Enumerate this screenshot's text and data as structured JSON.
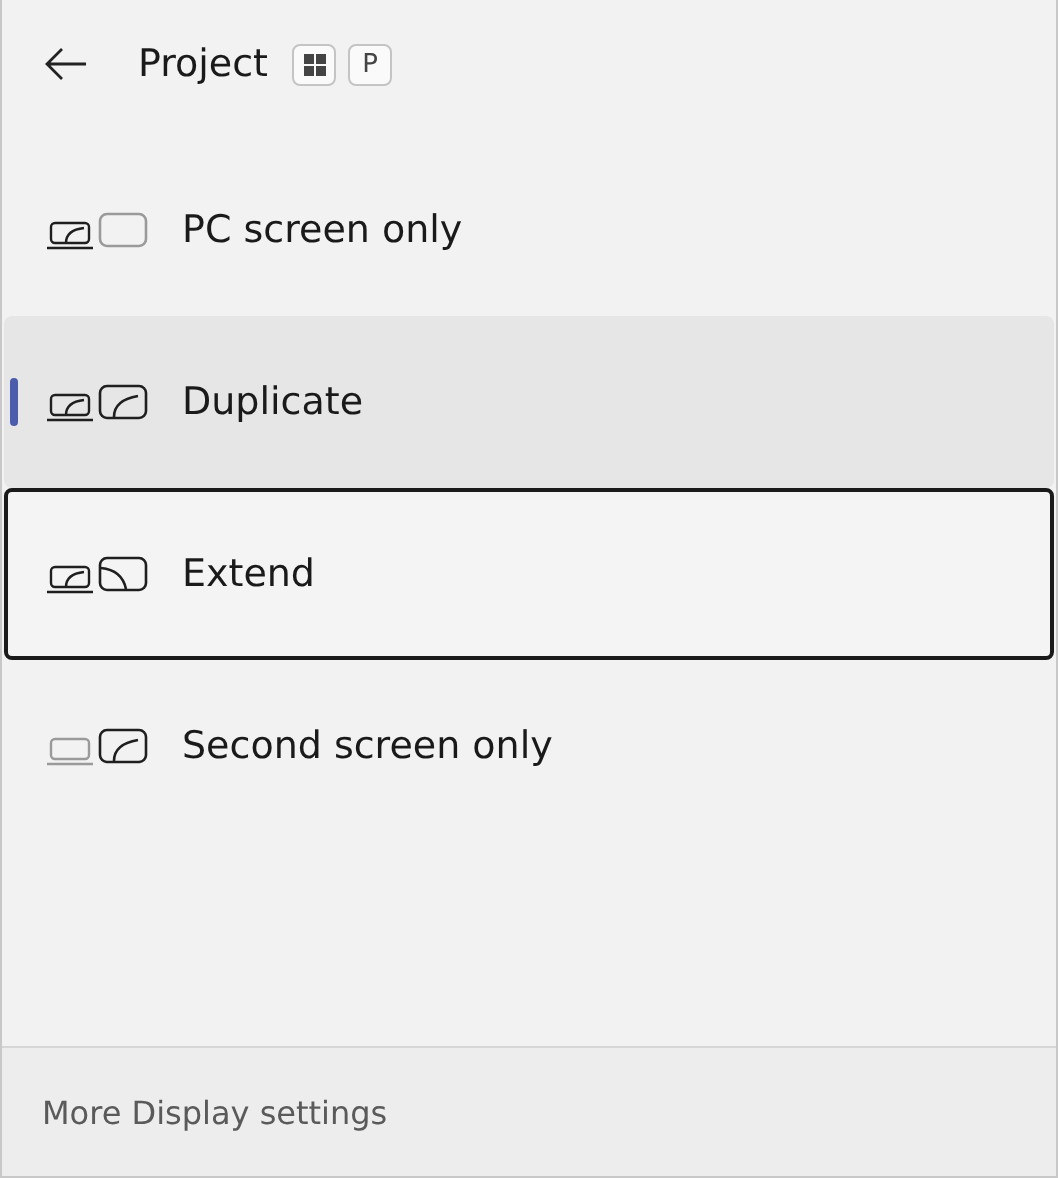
{
  "header": {
    "title": "Project",
    "shortcut_key": "P"
  },
  "options": [
    {
      "kind": "pc_only",
      "label": "PC screen only",
      "selected": false,
      "focused": false
    },
    {
      "kind": "duplicate",
      "label": "Duplicate",
      "selected": true,
      "focused": false
    },
    {
      "kind": "extend",
      "label": "Extend",
      "selected": false,
      "focused": true
    },
    {
      "kind": "second_only",
      "label": "Second screen only",
      "selected": false,
      "focused": false
    }
  ],
  "footer": {
    "link": "More Display settings"
  }
}
